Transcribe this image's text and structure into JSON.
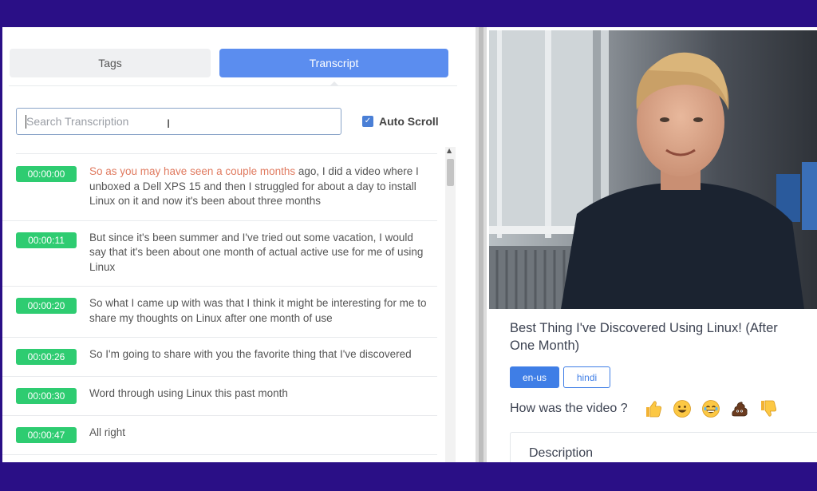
{
  "tabs": {
    "tags": "Tags",
    "transcript": "Transcript",
    "active": "Transcript"
  },
  "search": {
    "placeholder": "Search Transcription",
    "value": ""
  },
  "auto_scroll": {
    "label": "Auto Scroll",
    "checked": true
  },
  "transcript": [
    {
      "time": "00:00:00",
      "highlight": "So as you may have seen a couple months",
      "text": " ago, I did a video where I unboxed a Dell XPS 15 and then I struggled for about a day to install Linux on it and now it's been about three months"
    },
    {
      "time": "00:00:11",
      "highlight": "",
      "text": "But since it's been summer and I've tried out some vacation, I would say that it's been about one month of actual active use for me of using Linux"
    },
    {
      "time": "00:00:20",
      "highlight": "",
      "text": "So what I came up with was that I think it might be interesting for me to share my thoughts on Linux after one month of use"
    },
    {
      "time": "00:00:26",
      "highlight": "",
      "text": "So I'm going to share with you the favorite thing that I've discovered"
    },
    {
      "time": "00:00:30",
      "highlight": "",
      "text": "Word through using Linux this past month"
    },
    {
      "time": "00:00:47",
      "highlight": "",
      "text": "All right"
    }
  ],
  "video": {
    "title": "Best Thing I've Discovered Using Linux! (After One Month)"
  },
  "languages": {
    "primary": "en-us",
    "secondary": "hindi",
    "selected": "en-us"
  },
  "rating": {
    "question": "How was the video ?",
    "reactions": [
      "thumbs-up",
      "grinning-face",
      "laughing-face",
      "poop",
      "thumbs-down"
    ]
  },
  "description": {
    "heading": "Description"
  },
  "colors": {
    "frame": "#2a0f86",
    "accent": "#5b8def",
    "timestamp": "#2ecc71",
    "highlight": "#e07a5f"
  }
}
